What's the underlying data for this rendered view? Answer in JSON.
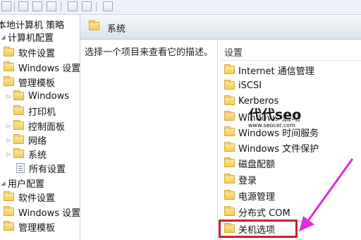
{
  "tree": {
    "title": "本地计算机 策略",
    "items": [
      {
        "label": "计算机配置"
      },
      {
        "label": "软件设置"
      },
      {
        "label": "Windows 设置"
      },
      {
        "label": "管理模板"
      },
      {
        "label": "Windows"
      },
      {
        "label": "打印机"
      },
      {
        "label": "控制面板"
      },
      {
        "label": "网络"
      },
      {
        "label": "系统"
      },
      {
        "label": "所有设置"
      },
      {
        "label": "用户配置"
      },
      {
        "label": "软件设置"
      },
      {
        "label": "Windows 设置"
      },
      {
        "label": "管理模板"
      }
    ]
  },
  "header": {
    "title": "系统"
  },
  "description": "选择一个项目来查看它的描述。",
  "list": {
    "column_header": "设置",
    "items": [
      {
        "label": "Internet 通信管理"
      },
      {
        "label": "iSCSI"
      },
      {
        "label": "Kerberos"
      },
      {
        "label": "Windows 启动"
      },
      {
        "label": "Windows 时间服务"
      },
      {
        "label": "Windows 文件保护"
      },
      {
        "label": "磁盘配额"
      },
      {
        "label": "登录"
      },
      {
        "label": "电源管理"
      },
      {
        "label": "分布式 COM"
      },
      {
        "label": "关机选项"
      }
    ]
  },
  "watermark": {
    "main": "代代seo",
    "sub": "www.seocer.com"
  },
  "colors": {
    "highlight": "#c8232c",
    "arrow": "#e12bd6"
  }
}
